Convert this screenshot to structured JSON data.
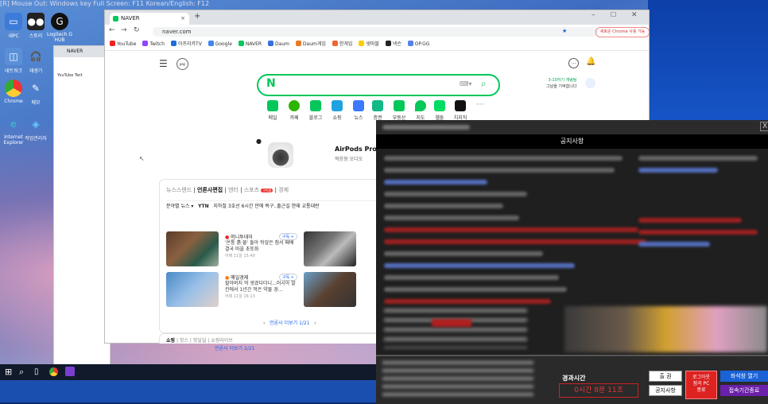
{
  "top_strip": "[R] Mouse Out: Windows key   Full Screen: F11   Korean/English: F12",
  "desktop_icons": [
    "내PC",
    "스토리",
    "Logitech G HUB",
    "네트워크",
    "재생기",
    "메모",
    "Chrome",
    "휴지통",
    "Internet Explorer",
    "작업관리자"
  ],
  "browser": {
    "tab_title": "NAVER",
    "url": "naver.com",
    "chrome_update": "새로운 Chrome 사용 가능",
    "bookmarks": [
      "YouTube",
      "Twitch",
      "아프리카TV",
      "Google",
      "NAVER",
      "Daum",
      "Daum게임",
      "한게임",
      "넷마블",
      "넥슨",
      "OP.GG"
    ]
  },
  "back_window": {
    "tab": "NAVER",
    "bookmark1": "YouTube",
    "bookmark2": "Twit"
  },
  "naver": {
    "logo": "N",
    "services": [
      "메일",
      "카페",
      "블로그",
      "쇼핑",
      "뉴스",
      "증권",
      "부동산",
      "지도",
      "웹툰",
      "치지직"
    ],
    "challenge_line1": "3-15하기 개념팀",
    "challenge_line2": "그날을 기억합니다",
    "ad_title": "AirPods Pro",
    "ad_sub": "적응형 오디오",
    "news_tabs": [
      "뉴스스탠드",
      "언론사편집",
      "엔터",
      "스포츠",
      "경제"
    ],
    "news_badge": "구독중",
    "ticker_source": "분야별 뉴스",
    "ticker_press": "YTN",
    "ticker_text": "지하철 3호선 6시간 만에 복구..출근길 한때 교통대란",
    "articles": [
      {
        "press": "머니투데이",
        "headline": "'온통 흙·물' 돌아 뒤엎은 첨서 패배 결국 마을 초토화",
        "date": "어제 11일 15:49"
      },
      {
        "press": "매일경제",
        "headline": "할아버지 딱 생겼다더니...러시아 발칸에서 1년간 먹은 약물 경...",
        "date": "어제 11일 16:13"
      }
    ],
    "subscribe": "구독 +",
    "pager": "언론사 더보기 1/21",
    "pager2": "언론사 더보기 2/21",
    "shop_tabs": [
      "쇼핑",
      "핫스",
      "핫딜딜",
      "쇼핑라이브"
    ]
  },
  "notice": {
    "title": "공지사항",
    "elapsed_label": "경과시간",
    "elapsed_value": "0시간 8분 11초",
    "btn_checkin": "출   권",
    "btn_notice": "공지사항",
    "btn_logout": "로그아웃\n점곡 PC\n종료",
    "btn_open_seat": "좌석창 열기",
    "btn_expire": "접속기간종료",
    "close": "X"
  },
  "colors": {
    "naver_green": "#03c75a",
    "notice_red": "#d22",
    "button_blue": "#1a62d8",
    "button_purple": "#6a20a8"
  }
}
